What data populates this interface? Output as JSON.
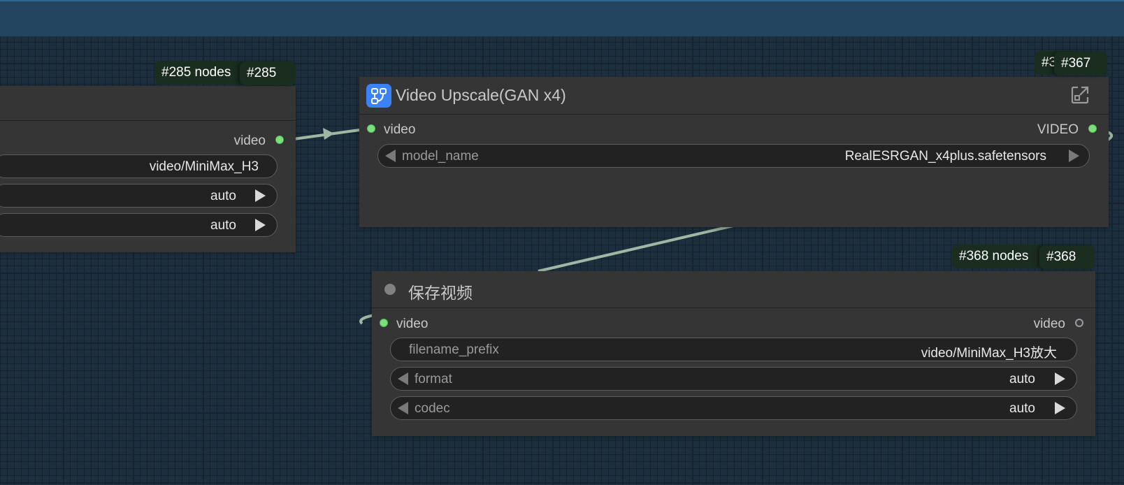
{
  "canvas": {
    "background": "#1d2f3f",
    "link_color": "#9fb8a4",
    "accent_green": "#7be07b"
  },
  "nodes": {
    "left_node": {
      "badge_back": "#285 nodes",
      "badge_front": "#285",
      "output_label": "video",
      "widgets": [
        {
          "value": "video/MiniMax_H3"
        },
        {
          "value": "auto"
        },
        {
          "value": "auto"
        }
      ]
    },
    "upscale_node": {
      "badge_back": "#3",
      "badge_front": "#367",
      "title": "Video Upscale(GAN x4)",
      "icon": "workflow-icon",
      "action_icon": "expand-icon",
      "input_label": "video",
      "output_label": "VIDEO",
      "widget": {
        "label": "model_name",
        "value": "RealESRGAN_x4plus.safetensors"
      }
    },
    "save_node": {
      "badge_back": "#368 nodes",
      "badge_front": "#368",
      "title": "保存视频",
      "input_label": "video",
      "output_label": "video",
      "widgets": [
        {
          "label": "filename_prefix",
          "value": "video/MiniMax_H3放大"
        },
        {
          "label": "format",
          "value": "auto"
        },
        {
          "label": "codec",
          "value": "auto"
        }
      ]
    }
  }
}
